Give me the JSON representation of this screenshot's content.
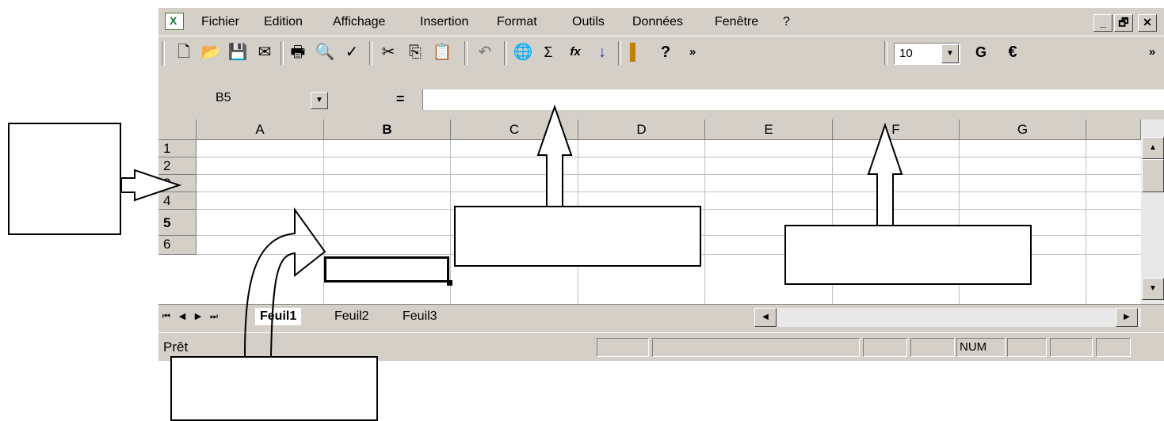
{
  "menubar": {
    "items": [
      {
        "label": "Fichier",
        "accel": "F"
      },
      {
        "label": "Edition",
        "accel": "E"
      },
      {
        "label": "Affichage",
        "accel": "A"
      },
      {
        "label": "Insertion",
        "accel": "I"
      },
      {
        "label": "Format",
        "accel": "t"
      },
      {
        "label": "Outils",
        "accel": "O"
      },
      {
        "label": "Données",
        "accel": "D"
      },
      {
        "label": "Fenêtre",
        "accel": "n"
      },
      {
        "label": "?",
        "accel": "?"
      }
    ],
    "window_buttons": {
      "minimize": "_",
      "restore": "🗗",
      "close": "✕"
    }
  },
  "toolbar": {
    "icons": [
      "new-document-icon",
      "open-folder-icon",
      "save-icon",
      "email-icon",
      "print-icon",
      "print-preview-icon",
      "spellcheck-icon",
      "cut-icon",
      "copy-icon",
      "paste-icon",
      "undo-icon",
      "hyperlink-icon",
      "autosum-icon",
      "function-icon",
      "sort-ascending-icon",
      "chart-wizard-icon",
      "help-icon"
    ],
    "glyphs": {
      "new": "🗋",
      "open": "📂",
      "save": "💾",
      "email": "✉",
      "print": "🖶",
      "preview": "🔍",
      "spell": "✓",
      "cut": "✂",
      "copy": "⎘",
      "paste": "📋",
      "undo": "↶",
      "hyperlink": "🌐",
      "sum": "Σ",
      "fx": "fx",
      "sort": "↓",
      "chart": "▌",
      "help": "?",
      "more": "»"
    },
    "font_size": "10",
    "bold_label": "G",
    "currency_label": "€",
    "more_label": "»"
  },
  "formula_bar": {
    "name_box": "B5",
    "equals_label": "=",
    "formula": ""
  },
  "grid": {
    "columns": [
      "A",
      "B",
      "C",
      "D",
      "E",
      "F",
      "G"
    ],
    "active_column": "B",
    "rows": [
      "1",
      "2",
      "3",
      "4",
      "5",
      "6"
    ],
    "active_row": "5"
  },
  "sheet_tabs": [
    {
      "label": "Feuil1",
      "active": true
    },
    {
      "label": "Feuil2",
      "active": false
    },
    {
      "label": "Feuil3",
      "active": false
    }
  ],
  "status": {
    "text": "Prêt",
    "num_indicator": "NUM"
  },
  "colors": {
    "face": "#d4d0c8",
    "shadow": "#808080",
    "gridline": "#c0c0c0",
    "excel_green": "#157f2c"
  }
}
